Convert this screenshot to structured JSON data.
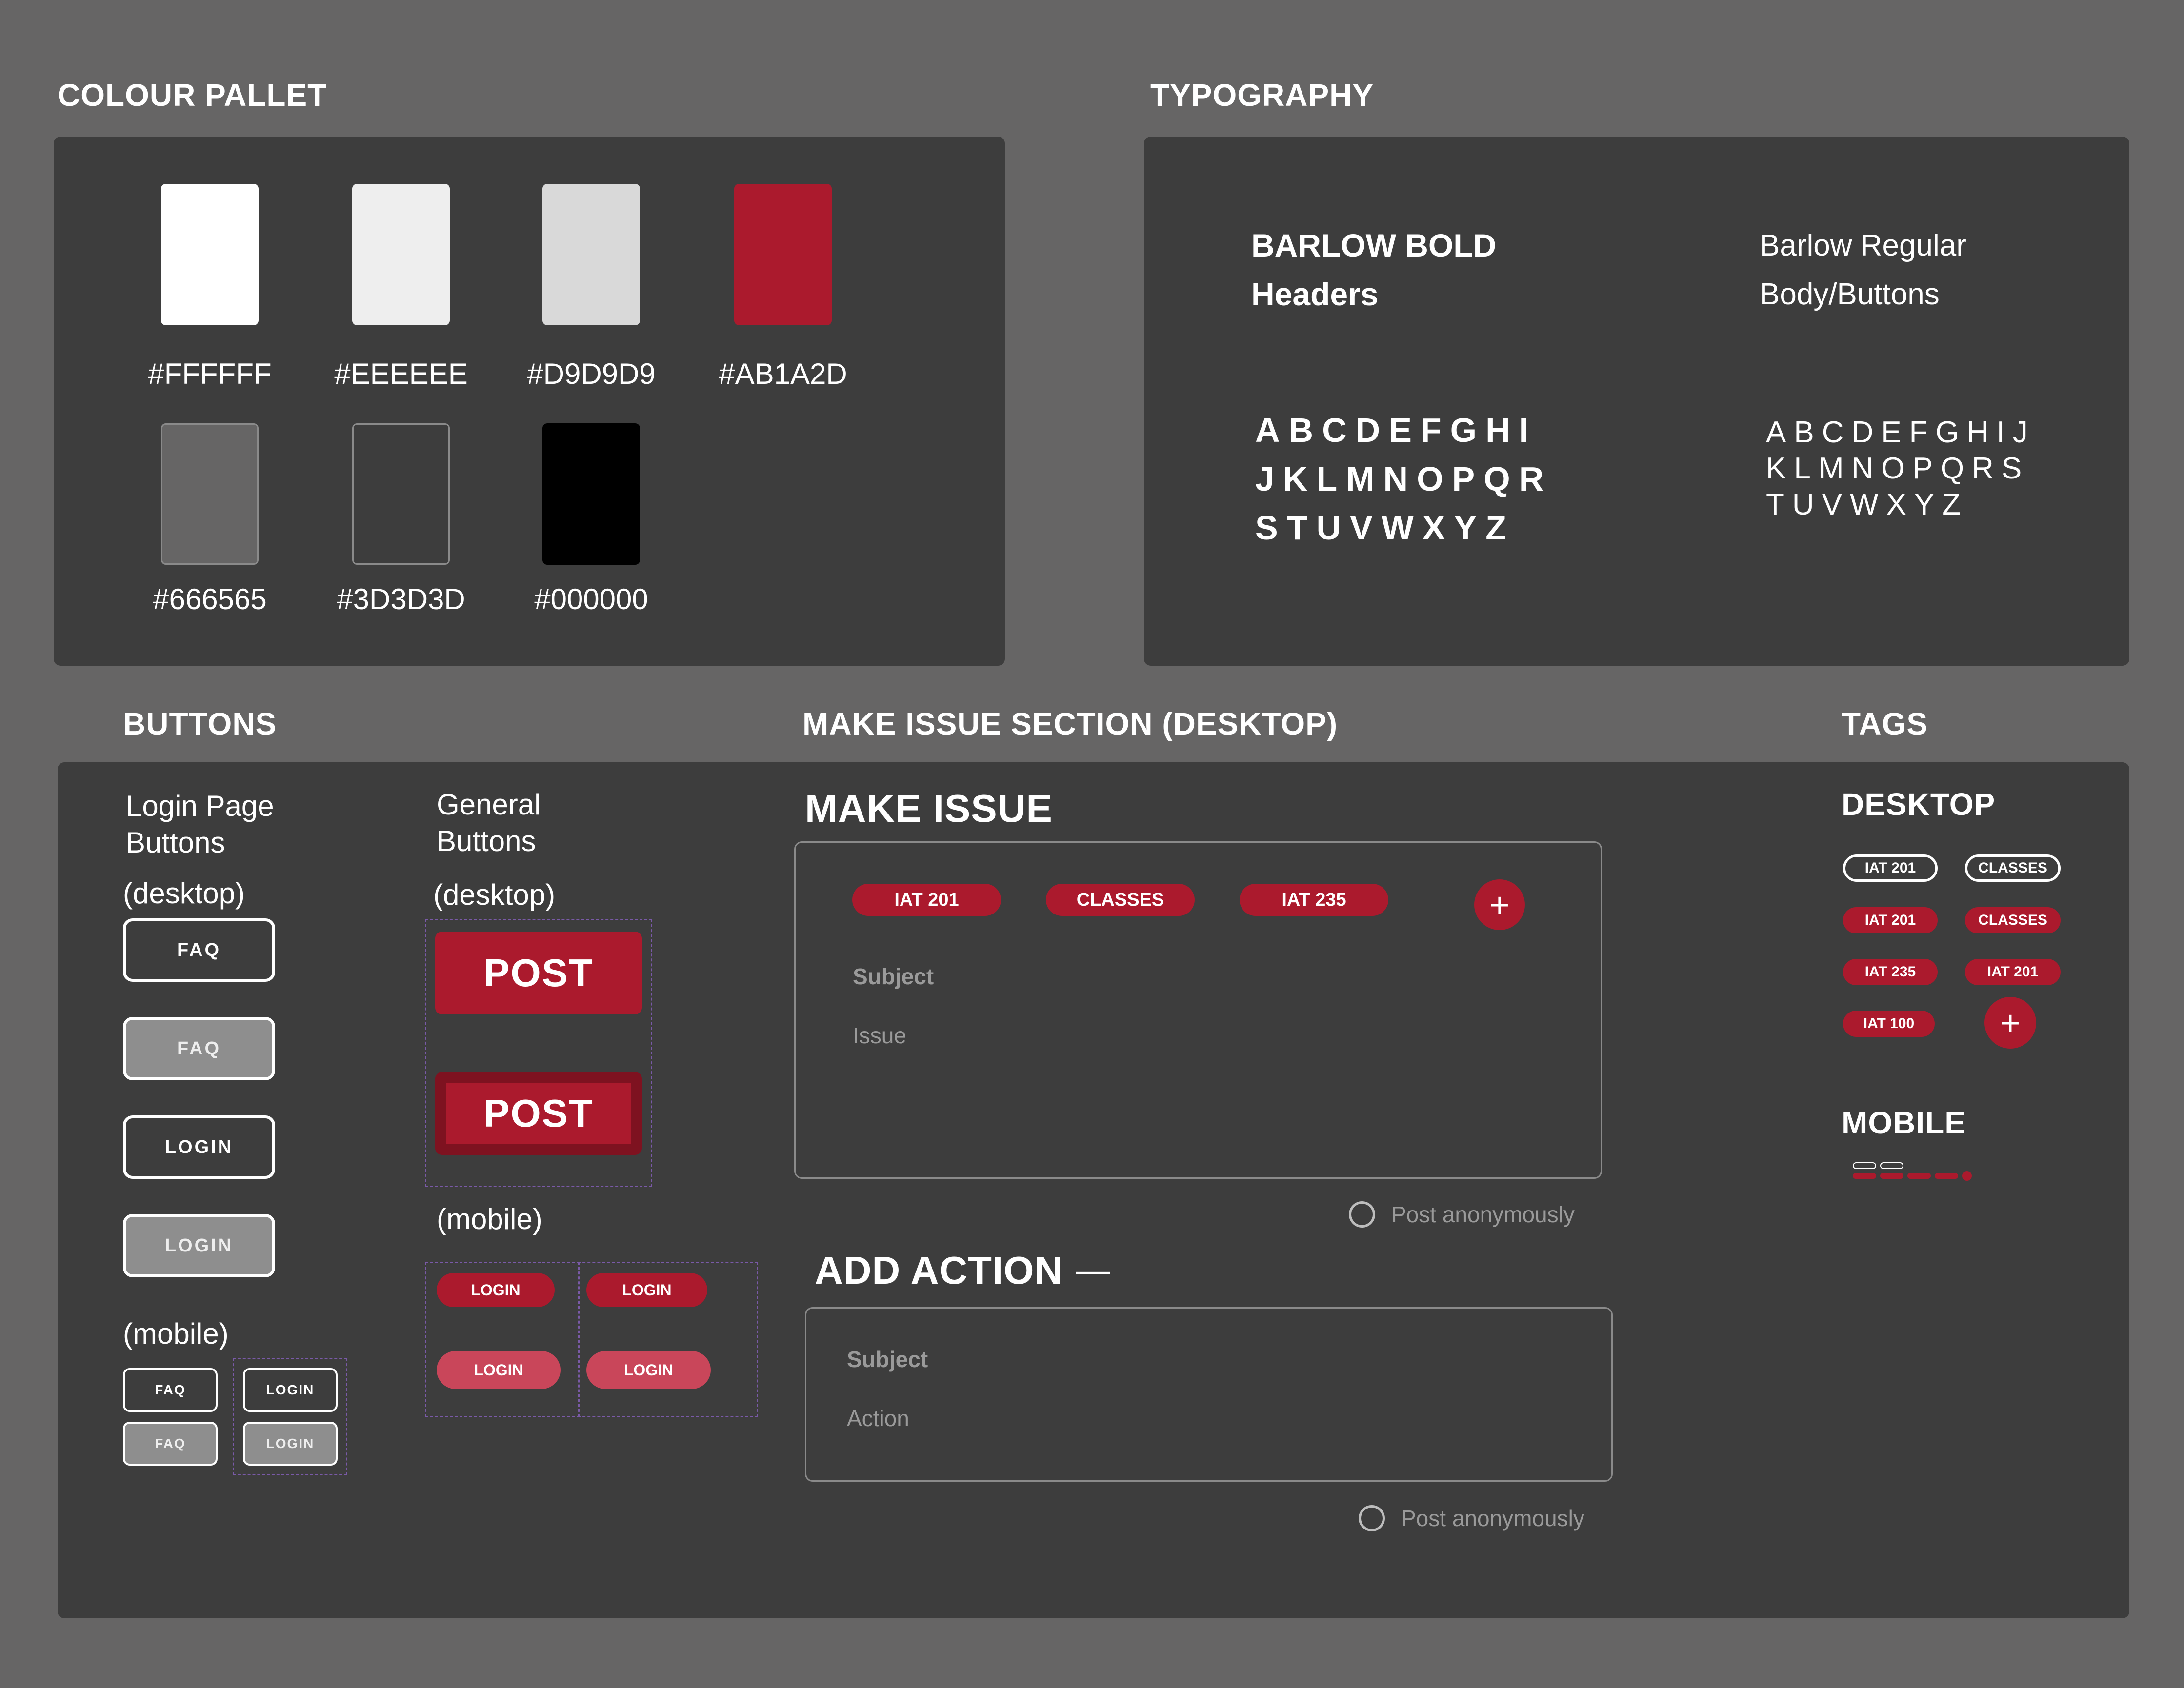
{
  "colour_section": {
    "title": "COLOUR PALLET",
    "swatches": [
      {
        "color": "#FFFFFF",
        "label": "#FFFFFF"
      },
      {
        "color": "#EEEEEE",
        "label": "#EEEEEE"
      },
      {
        "color": "#D9D9D9",
        "label": "#D9D9D9"
      },
      {
        "color": "#AB1A2D",
        "label": "#AB1A2D"
      },
      {
        "color": "#666565",
        "label": "#666565"
      },
      {
        "color": "#3D3D3D",
        "label": "#3D3D3D"
      },
      {
        "color": "#000000",
        "label": "#000000"
      }
    ]
  },
  "typography_section": {
    "title": "TYPOGRAPHY",
    "bold_name": "BARLOW BOLD",
    "bold_use": "Headers",
    "regular_name": "Barlow Regular",
    "regular_use": "Body/Buttons",
    "bold_alphabet": [
      "ABCDEFGHI",
      "JKLMNOPQR",
      "STUVWXYZ"
    ],
    "regular_alphabet": [
      "ABCDEFGHIJ",
      "KLMNOPQRS",
      "TUVWXYZ"
    ]
  },
  "buttons_section": {
    "title": "BUTTONS",
    "login_heading_1": "Login Page",
    "login_heading_2": "Buttons",
    "desktop_label": "(desktop)",
    "mobile_label": "(mobile)",
    "general_heading_1": "General",
    "general_heading_2": "Buttons",
    "faq": "FAQ",
    "login": "LOGIN",
    "post": "POST"
  },
  "make_issue_section": {
    "title": "MAKE ISSUE SECTION (DESKTOP)",
    "heading": "MAKE ISSUE",
    "tags": [
      "IAT 201",
      "CLASSES",
      "IAT 235"
    ],
    "plus": "+",
    "subject_label": "Subject",
    "issue_placeholder": "Issue",
    "post_anonymously": "Post anonymously",
    "add_action_heading": "ADD ACTION",
    "collapse_symbol": "—",
    "action_subject_label": "Subject",
    "action_placeholder": "Action"
  },
  "tags_section": {
    "title": "TAGS",
    "desktop_heading": "DESKTOP",
    "mobile_heading": "MOBILE",
    "outline_tags": [
      "IAT 201",
      "CLASSES"
    ],
    "red_tags": [
      "IAT 201",
      "CLASSES",
      "IAT 235",
      "IAT 201",
      "IAT 100"
    ],
    "plus": "+"
  }
}
